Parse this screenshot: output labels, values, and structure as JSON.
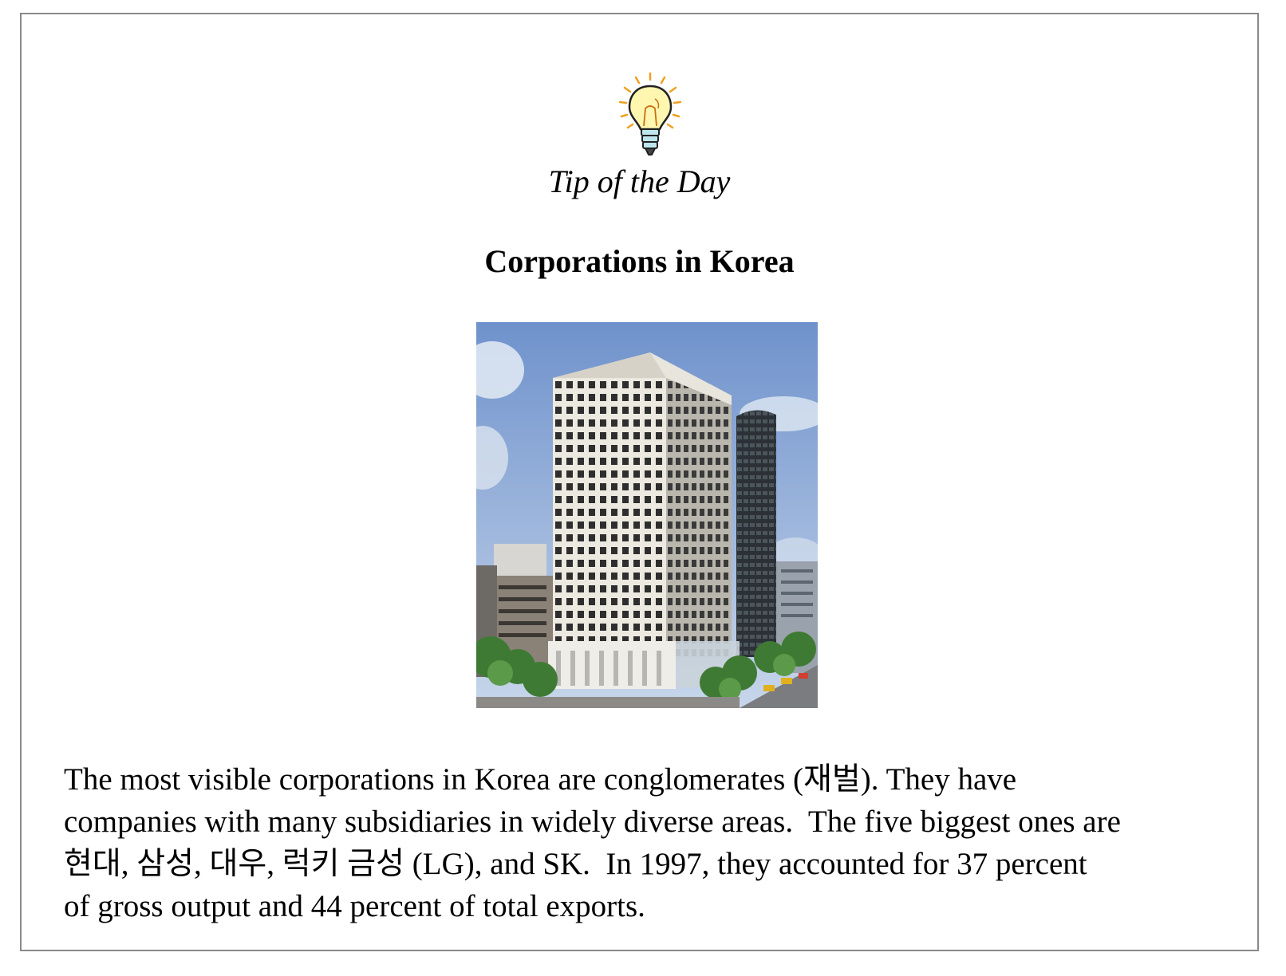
{
  "tip": {
    "label": "Tip of the Day",
    "icon": "lightbulb-icon",
    "accent": "#f0a020"
  },
  "article": {
    "title": "Corporations in Korea",
    "image": "office-tower-photo",
    "body": "The most visible corporations in Korea are conglomerates (재벌). They have\ncompanies with many subsidiaries in widely diverse areas.  The five biggest ones are\n현대, 삼성, 대우, 럭키 금성 (LG), and SK.  In 1997, they accounted for 37 percent\nof gross output and 44 percent of total exports."
  }
}
